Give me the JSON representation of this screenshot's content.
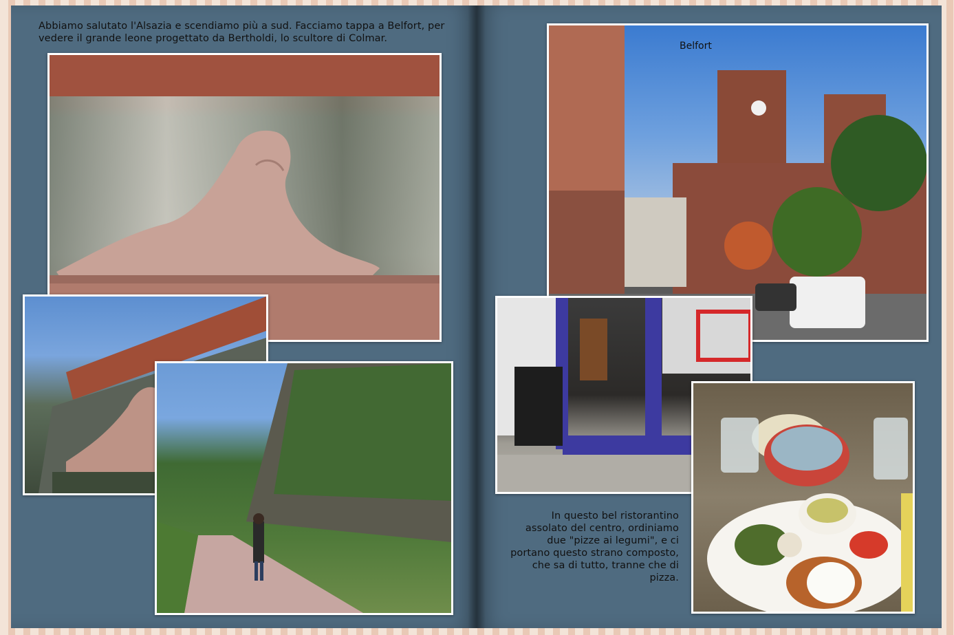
{
  "left_page": {
    "caption": "Abbiamo salutato l'Alsazia e scendiamo più a sud. Facciamo tappa a Belfort, per vedere il grande leone progettato da Bertholdi, lo scultore di Colmar."
  },
  "right_page": {
    "photo_label": "Belfort",
    "caption": "In questo bel ristorantino assolato del centro, ordiniamo due \"pizze ai legumi\", e ci portano questo strano composto, che sa di tutto, tranne che di pizza."
  }
}
